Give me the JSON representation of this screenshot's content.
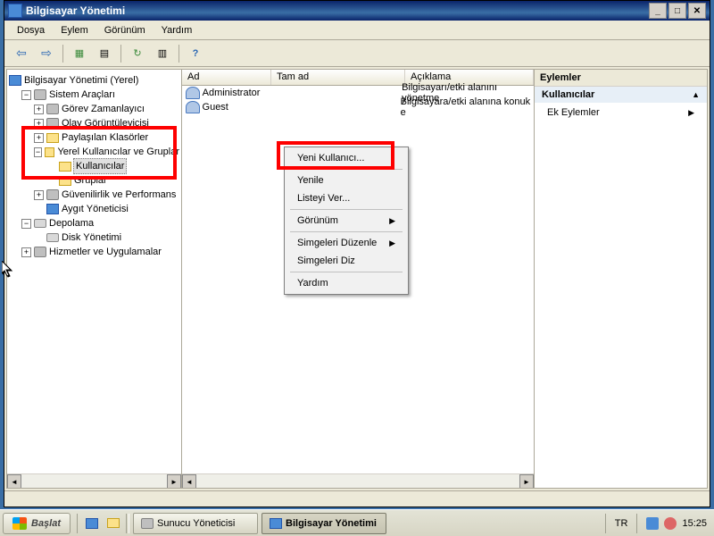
{
  "window": {
    "title": "Bilgisayar Yönetimi"
  },
  "menu": {
    "file": "Dosya",
    "action": "Eylem",
    "view": "Görünüm",
    "help": "Yardım"
  },
  "tree": {
    "root": "Bilgisayar Yönetimi (Yerel)",
    "system_tools": "Sistem Araçları",
    "task_scheduler": "Görev Zamanlayıcı",
    "event_viewer": "Olay Görüntüleyicisi",
    "shared_folders": "Paylaşılan Klasörler",
    "local_users_groups": "Yerel Kullanıcılar ve Gruplar",
    "users": "Kullanıcılar",
    "groups": "Gruplar",
    "reliability_perf": "Güvenilirlik ve Performans",
    "device_manager": "Aygıt Yöneticisi",
    "storage": "Depolama",
    "disk_management": "Disk Yönetimi",
    "services_apps": "Hizmetler ve Uygulamalar"
  },
  "list": {
    "col_name": "Ad",
    "col_full_name": "Tam ad",
    "col_desc": "Açıklama",
    "rows": [
      {
        "name": "Administrator",
        "desc": "Bilgisayarı/etki alanını yönetme"
      },
      {
        "name": "Guest",
        "desc": "Bilgisayara/etki alanına konuk e"
      }
    ]
  },
  "actions": {
    "title": "Eylemler",
    "group": "Kullanıcılar",
    "more": "Ek Eylemler"
  },
  "context": {
    "new_user": "Yeni Kullanıcı...",
    "refresh": "Yenile",
    "export_list": "Listeyi Ver...",
    "view": "Görünüm",
    "arrange_icons": "Simgeleri Düzenle",
    "line_up_icons": "Simgeleri Diz",
    "help": "Yardım"
  },
  "taskbar": {
    "start": "Başlat",
    "task1": "Sunucu Yöneticisi",
    "task2": "Bilgisayar Yönetimi",
    "lang": "TR",
    "clock": "15:25"
  }
}
